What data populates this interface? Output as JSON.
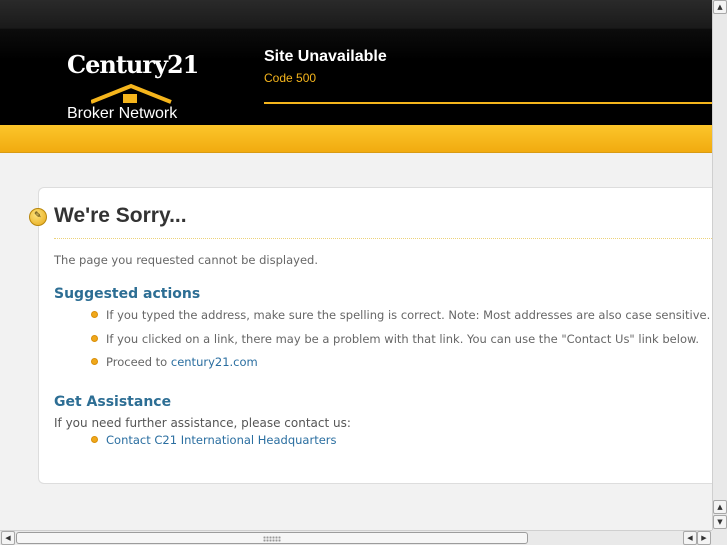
{
  "header": {
    "logo_name": "Century21",
    "logo_sub": "Broker Network",
    "site_title": "Site Unavailable",
    "site_code": "Code 500"
  },
  "content": {
    "heading": "We're Sorry...",
    "message": "The page you requested cannot be displayed.",
    "suggested": {
      "title": "Suggested actions",
      "items": [
        "If you typed the address, make sure the spelling is correct. Note: Most addresses are also case sensitive.",
        "If you clicked on a link, there may be a problem with that link. You can use the \"Contact Us\" link below.",
        "Proceed to "
      ],
      "proceed_link": "century21.com"
    },
    "assistance": {
      "title": "Get Assistance",
      "text": "If you need further assistance, please contact us:",
      "contact_link": "Contact C21 International Headquarters"
    }
  },
  "colors": {
    "brand_gold": "#f5b51c",
    "link_blue": "#2a6ea0",
    "heading_blue": "#2d6e94"
  },
  "icons": [
    "sorry-speech-icon",
    "bullet-icon",
    "scroll-up-icon",
    "scroll-down-icon",
    "scroll-left-icon",
    "scroll-right-icon"
  ]
}
